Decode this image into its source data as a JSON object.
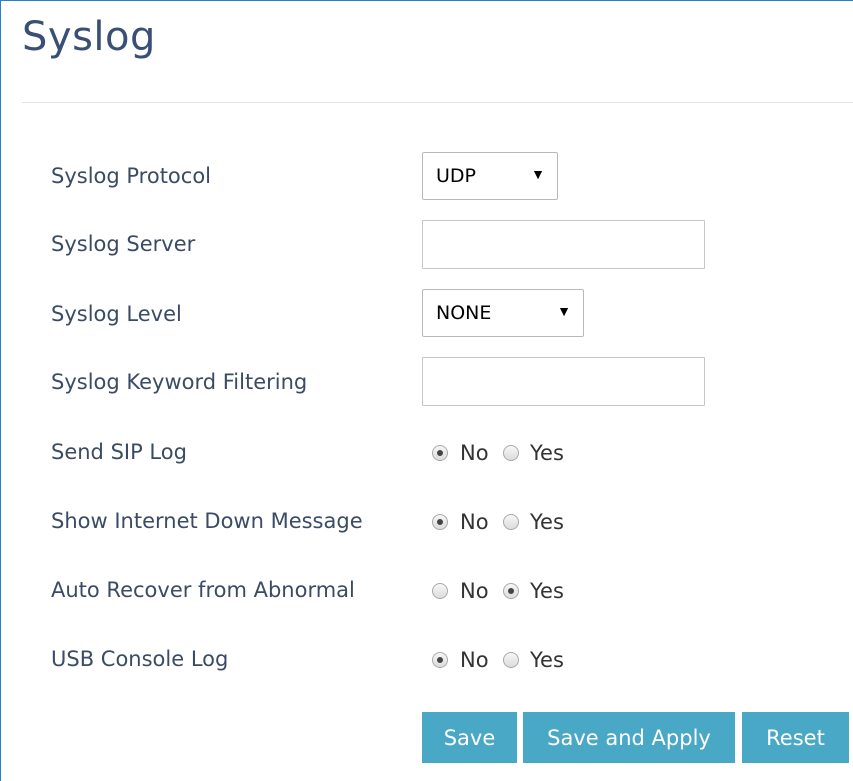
{
  "page": {
    "title": "Syslog"
  },
  "fields": {
    "protocol": {
      "label": "Syslog Protocol",
      "value": "UDP"
    },
    "server": {
      "label": "Syslog Server",
      "value": ""
    },
    "level": {
      "label": "Syslog Level",
      "value": "NONE"
    },
    "keyword": {
      "label": "Syslog Keyword Filtering",
      "value": ""
    },
    "sip_log": {
      "label": "Send SIP Log",
      "selected": "No"
    },
    "internet_down": {
      "label": "Show Internet Down Message",
      "selected": "No"
    },
    "auto_recover": {
      "label": "Auto Recover from Abnormal",
      "selected": "Yes"
    },
    "usb_console": {
      "label": "USB Console Log",
      "selected": "No"
    }
  },
  "radio_options": {
    "no": "No",
    "yes": "Yes"
  },
  "buttons": {
    "save": "Save",
    "save_apply": "Save and Apply",
    "reset": "Reset"
  },
  "colors": {
    "border": "#2f7fc7",
    "button": "#4aa8c7",
    "title": "#3a4f74"
  }
}
